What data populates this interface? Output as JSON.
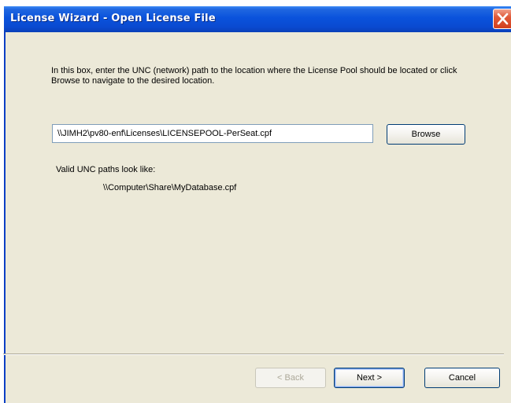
{
  "window": {
    "title": "License Wizard - Open License File"
  },
  "content": {
    "instructions": "In this box, enter the UNC (network) path to the location where the License Pool should be located or click Browse to navigate to the desired location.",
    "path_value": "\\\\JIMH2\\pv80-enf\\Licenses\\LICENSEPOOL-PerSeat.cpf",
    "browse_label": "Browse",
    "valid_label": "Valid UNC paths look like:",
    "valid_example": "\\\\Computer\\Share\\MyDatabase.cpf"
  },
  "footer": {
    "back_label": "< Back",
    "next_label": "Next >",
    "cancel_label": "Cancel"
  },
  "icons": {
    "close": "close-icon"
  }
}
